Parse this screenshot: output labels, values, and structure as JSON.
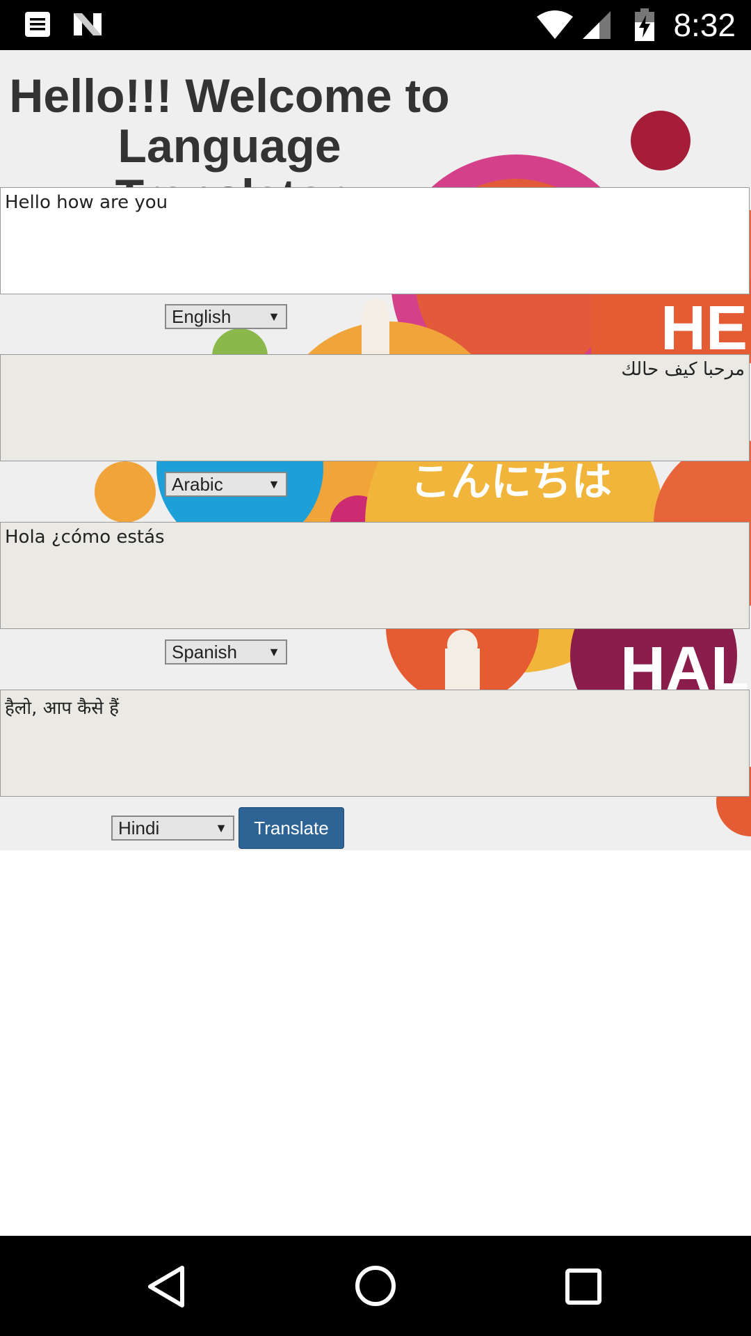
{
  "status_bar": {
    "time": "8:32",
    "icons": [
      "notes-icon",
      "n-logo-icon",
      "wifi-icon",
      "signal-icon",
      "battery-charging-icon"
    ]
  },
  "app": {
    "title": "Hello!!! Welcome to Language Translator",
    "title_line1": "Hello!!! Welcome to",
    "title_line2": "Language Translator",
    "source_text": "Hello how are you",
    "source_language": "English",
    "outputs": [
      {
        "text": "مرحبا كيف حالك",
        "language": "Arabic"
      },
      {
        "text": "Hola ¿cómo estás",
        "language": "Spanish"
      },
      {
        "text": "हैलो, आप कैसे हैं",
        "language": "Hindi"
      }
    ],
    "translate_label": "Translate",
    "background_words": [
      "HE",
      "こんにちは",
      "HALL"
    ]
  },
  "nav_bar": {
    "buttons": [
      "back-icon",
      "home-icon",
      "recents-icon"
    ]
  },
  "colors": {
    "button_blue": "#2e6396",
    "output_bg": "#ebe9e4",
    "page_bg": "#efefef"
  }
}
